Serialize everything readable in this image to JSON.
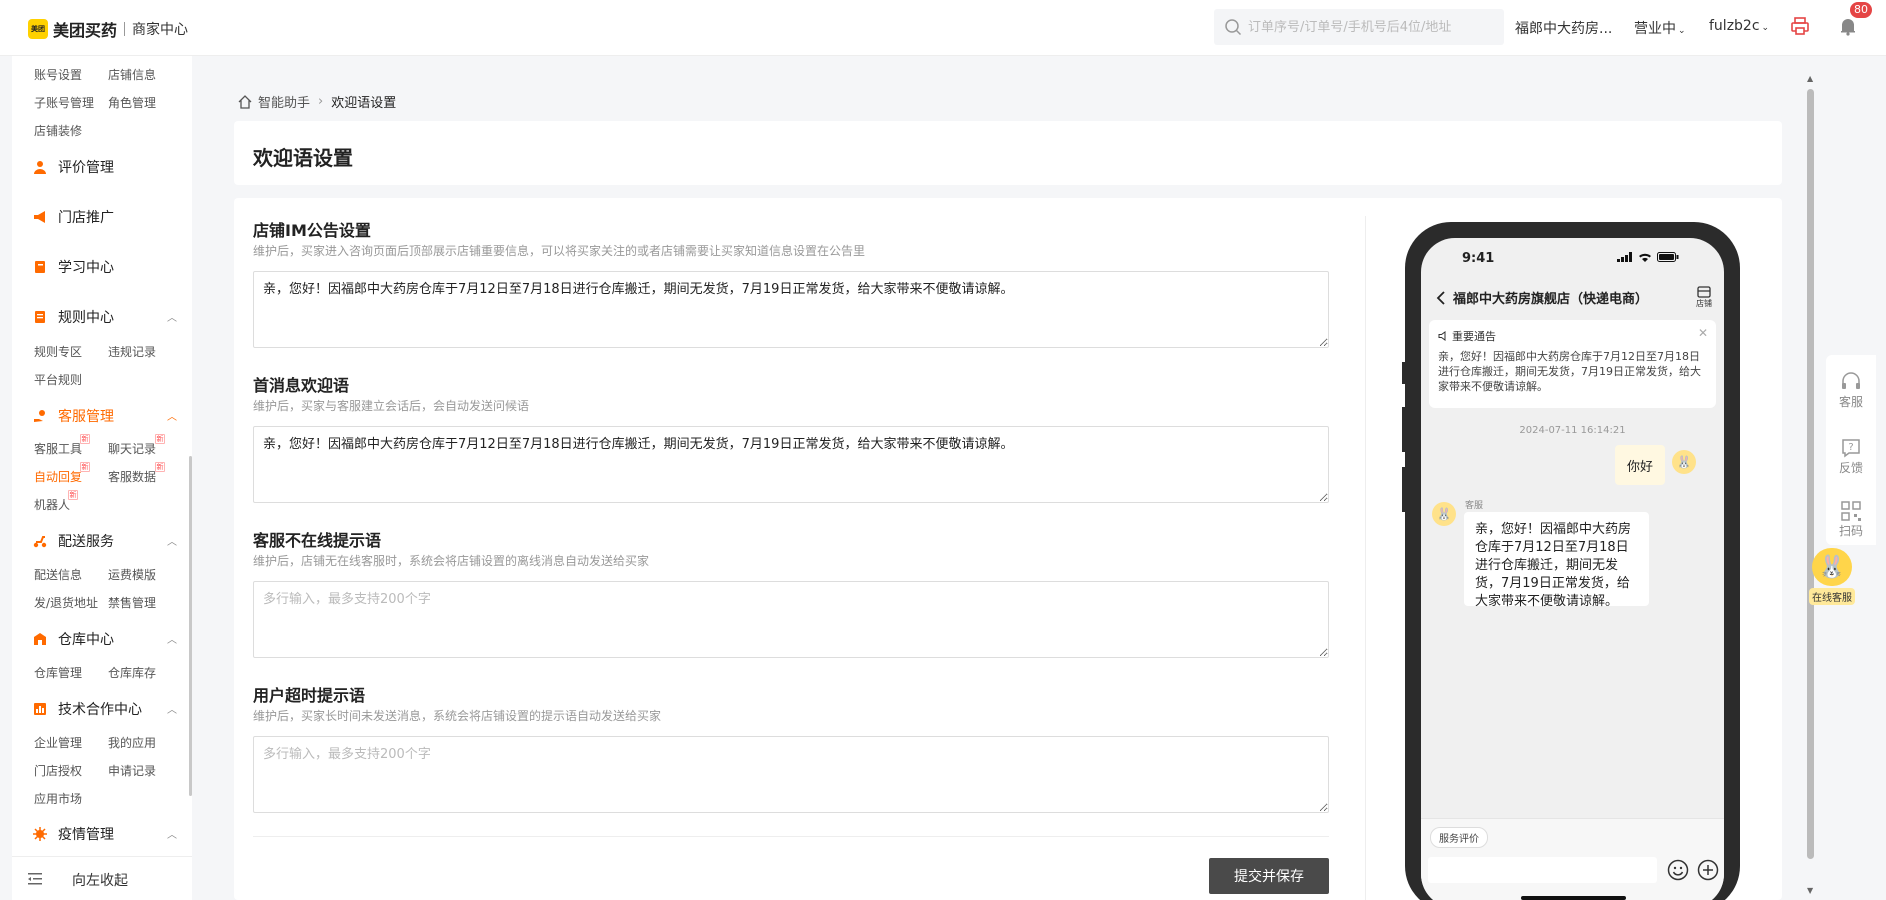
{
  "topbar": {
    "logo_mark": "美团",
    "logo_text": "美团买药",
    "logo_sub": "商家中心",
    "search_placeholder": "订单序号/订单号/手机号后4位/地址",
    "store_name": "福郎中大药房...",
    "status": "营业中",
    "user": "fulzb2c",
    "notification_count": "80"
  },
  "sidebar": {
    "account_items": [
      "账号设置",
      "店铺信息",
      "子账号管理",
      "角色管理",
      "店铺装修"
    ],
    "eval": "评价管理",
    "promo": "门店推广",
    "learn": "学习中心",
    "rules": {
      "label": "规则中心",
      "items": [
        "规则专区",
        "违规记录",
        "平台规则"
      ]
    },
    "service": {
      "label": "客服管理",
      "items": [
        "客服工具",
        "聊天记录",
        "自动回复",
        "客服数据",
        "机器人"
      ],
      "new_badge": "新"
    },
    "delivery": {
      "label": "配送服务",
      "items": [
        "配送信息",
        "运费模版",
        "发/退货地址",
        "禁售管理"
      ]
    },
    "warehouse": {
      "label": "仓库中心",
      "items": [
        "仓库管理",
        "仓库库存"
      ]
    },
    "tech": {
      "label": "技术合作中心",
      "items": [
        "企业管理",
        "我的应用",
        "门店授权",
        "申请记录",
        "应用市场"
      ]
    },
    "epidemic": "疫情管理",
    "collapse": "向左收起"
  },
  "breadcrumb": {
    "parent": "智能助手",
    "current": "欢迎语设置"
  },
  "page_title": "欢迎语设置",
  "form": {
    "notice": {
      "label": "店铺IM公告设置",
      "desc": "维护后，买家进入咨询页面后顶部展示店铺重要信息，可以将买家关注的或者店铺需要让买家知道信息设置在公告里",
      "value": "亲，您好！因福郎中大药房仓库于7月12日至7月18日进行仓库搬迁，期间无发货，7月19日正常发货，给大家带来不便敬请谅解。"
    },
    "welcome": {
      "label": "首消息欢迎语",
      "desc": "维护后，买家与客服建立会话后，会自动发送问候语",
      "value": "亲，您好！因福郎中大药房仓库于7月12日至7月18日进行仓库搬迁，期间无发货，7月19日正常发货，给大家带来不便敬请谅解。"
    },
    "offline": {
      "label": "客服不在线提示语",
      "desc": "维护后，店铺无在线客服时，系统会将店铺设置的离线消息自动发送给买家",
      "value": "",
      "placeholder": "多行输入，最多支持200个字"
    },
    "timeout": {
      "label": "用户超时提示语",
      "desc": "维护后，买家长时间未发送消息，系统会将店铺设置的提示语自动发送给买家",
      "value": "",
      "placeholder": "多行输入，最多支持200个字"
    },
    "submit": "提交并保存"
  },
  "phone": {
    "time": "9:41",
    "store_title": "福郎中大药房旗舰店（快递电商）",
    "store_icon_label": "店铺",
    "notice_title": "重要通告",
    "notice_text": "亲，您好！因福郎中大药房仓库于7月12日至7月18日进行仓库搬迁，期间无发货，7月19日正常发货，给大家带来不便敬请谅解。",
    "timestamp": "2024-07-11 16:14:21",
    "user_msg": "你好",
    "cs_name": "客服",
    "cs_msg": "亲，您好！因福郎中大药房仓库于7月12日至7月18日进行仓库搬迁，期间无发货，7月19日正常发货，给大家带来不便敬请谅解。",
    "service_eval": "服务评价"
  },
  "float_panel": {
    "service": "客服",
    "feedback": "反馈",
    "scan": "扫码",
    "online": "在线客服"
  },
  "colors": {
    "accent": "#ff6a00",
    "brand": "#ffd100",
    "badge": "#e54545"
  }
}
